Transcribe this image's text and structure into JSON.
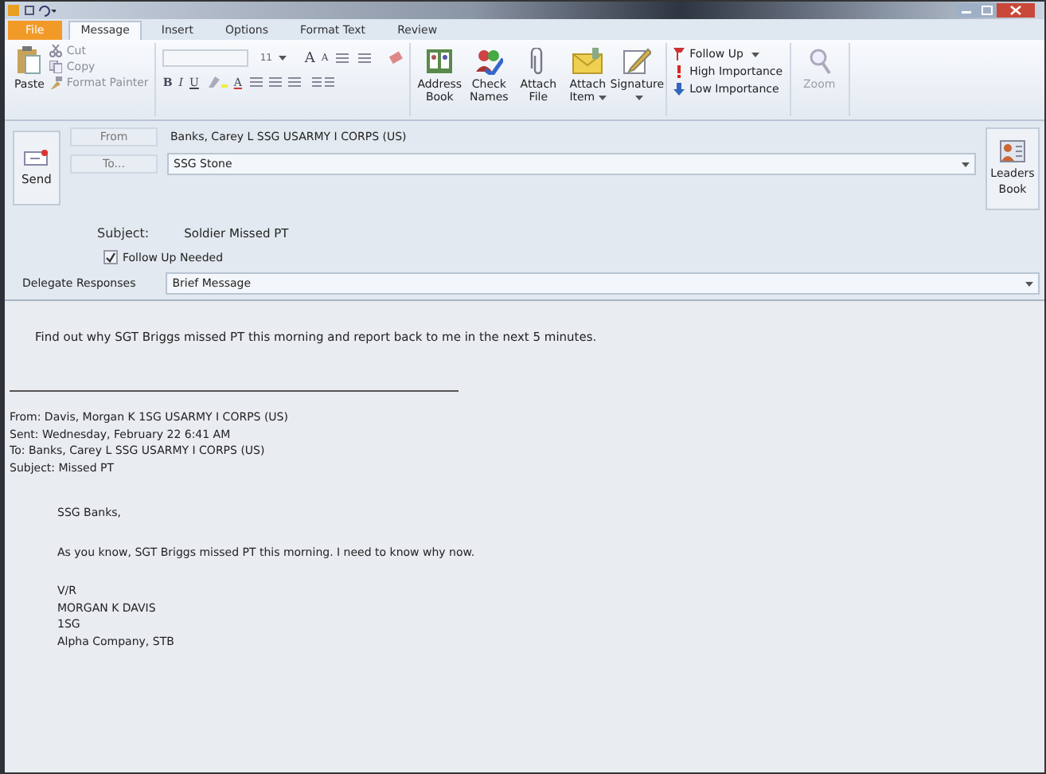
{
  "tabs": [
    {
      "label": "File",
      "kind": "file",
      "selected": false
    },
    {
      "label": "Message",
      "kind": "tab",
      "selected": true
    },
    {
      "label": "Insert",
      "kind": "tab",
      "selected": false
    },
    {
      "label": "Options",
      "kind": "tab",
      "selected": false
    },
    {
      "label": "Format Text",
      "kind": "tab",
      "selected": false
    },
    {
      "label": "Review",
      "kind": "tab",
      "selected": false
    }
  ],
  "ribbon": {
    "paste": "Paste",
    "clipboard": [
      {
        "label": "Cut",
        "kind": "cut",
        "disabled": true
      },
      {
        "label": "Copy",
        "kind": "copy",
        "disabled": true
      },
      {
        "label": "Format Painter",
        "kind": "painter",
        "disabled": true
      }
    ],
    "font_size": "11",
    "grow": "A",
    "shrink": "A",
    "formats": [
      "B",
      "I",
      "U"
    ],
    "font_color": "A",
    "large_buttons": [
      {
        "label": "Address Book",
        "kind": "book",
        "dropdown": false
      },
      {
        "label": "Check Names",
        "kind": "check",
        "dropdown": false
      },
      {
        "label": "Attach File",
        "kind": "clip",
        "dropdown": false
      },
      {
        "label": "Attach Item",
        "kind": "envelope",
        "dropdown": true
      },
      {
        "label": "Signature",
        "kind": "signature",
        "dropdown": true
      }
    ],
    "tags": [
      {
        "label": "Follow Up",
        "kind": "flag",
        "dropdown": true
      },
      {
        "label": "High Importance",
        "kind": "high",
        "dropdown": false
      },
      {
        "label": "Low Importance",
        "kind": "low",
        "dropdown": false
      }
    ],
    "zoom": {
      "label": "Zoom",
      "disabled": true
    }
  },
  "header": {
    "send": "Send",
    "from_button": "From",
    "from": "Banks, Carey L SSG USARMY I CORPS (US)",
    "to_button": "To...",
    "to": "SSG Stone",
    "leaders_book": "Leaders Book",
    "subject_label": "Subject:",
    "subject": "Soldier Missed PT",
    "follow_up": {
      "label": "Follow Up Needed",
      "checked": true
    },
    "delegate_label": "Delegate Responses",
    "delegate": "Brief Message"
  },
  "body": {
    "message": "Find out why SGT Briggs missed PT this morning and report back to me in the next 5 minutes.",
    "quoted_header": [
      "From: Davis, Morgan K 1SG USARMY I CORPS (US)",
      "Sent: Wednesday, February 22 6:41 AM",
      "To: Banks, Carey L SSG USARMY I CORPS (US)",
      "Subject: Missed PT"
    ],
    "greeting": "SSG Banks,",
    "paragraph": "As you know, SGT Briggs missed PT this morning. I need to know why now.",
    "signature": [
      "V/R",
      "MORGAN K DAVIS",
      "1SG",
      "Alpha Company, STB"
    ]
  }
}
